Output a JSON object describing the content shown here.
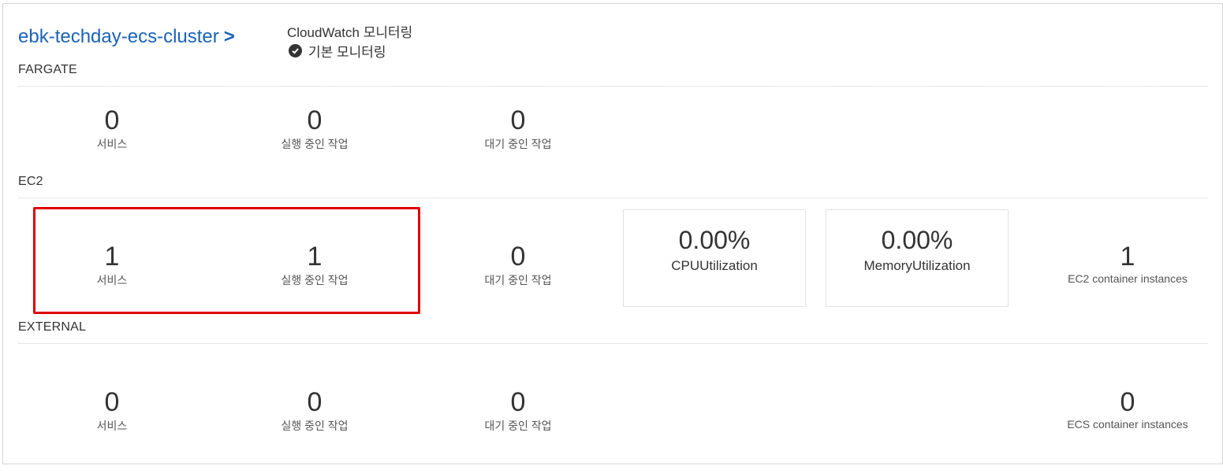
{
  "header": {
    "cluster_name": "ebk-techday-ecs-cluster",
    "cluster_arrow": ">",
    "cloudwatch_title": "CloudWatch 모니터링",
    "cloudwatch_status": "기본 모니터링",
    "status_icon": "check-circle-icon"
  },
  "fargate": {
    "label": "FARGATE",
    "stats": [
      {
        "value": "0",
        "label": "서비스"
      },
      {
        "value": "0",
        "label": "실행 중인 작업"
      },
      {
        "value": "0",
        "label": "대기 중인 작업"
      }
    ]
  },
  "ec2": {
    "label": "EC2",
    "stats": [
      {
        "value": "1",
        "label": "서비스"
      },
      {
        "value": "1",
        "label": "실행 중인 작업"
      },
      {
        "value": "0",
        "label": "대기 중인 작업"
      }
    ],
    "cpu": {
      "value": "0.00%",
      "label": "CPUUtilization"
    },
    "memory": {
      "value": "0.00%",
      "label": "MemoryUtilization"
    },
    "instances": {
      "value": "1",
      "label": "EC2 container instances"
    }
  },
  "external": {
    "label": "EXTERNAL",
    "stats": [
      {
        "value": "0",
        "label": "서비스"
      },
      {
        "value": "0",
        "label": "실행 중인 작업"
      },
      {
        "value": "0",
        "label": "대기 중인 작업"
      }
    ],
    "instances": {
      "value": "0",
      "label": "ECS container instances"
    }
  },
  "colors": {
    "link": "#1a63b8",
    "highlight": "#e00000",
    "text": "#333333"
  }
}
